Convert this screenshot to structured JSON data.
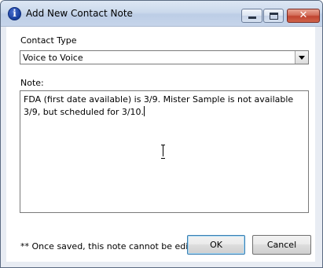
{
  "window": {
    "title": "Add New Contact Note"
  },
  "form": {
    "contact_type_label": "Contact Type",
    "contact_type_value": "Voice to Voice",
    "note_label": "Note:",
    "note_text": "FDA (first date available) is 3/9. Mister Sample is not available 3/9, but scheduled for 3/10."
  },
  "footer": {
    "warning": "** Once saved, this note cannot be edited",
    "ok_label": "OK",
    "cancel_label": "Cancel"
  },
  "colors": {
    "titlebar": "#cbd9ec",
    "close_button": "#c14430",
    "dialog_background": "#ffffff"
  },
  "icons": {
    "app_icon": "info-icon",
    "minimize": "minimize-icon",
    "maximize": "maximize-icon",
    "close": "close-icon",
    "dropdown": "chevron-down-icon"
  }
}
